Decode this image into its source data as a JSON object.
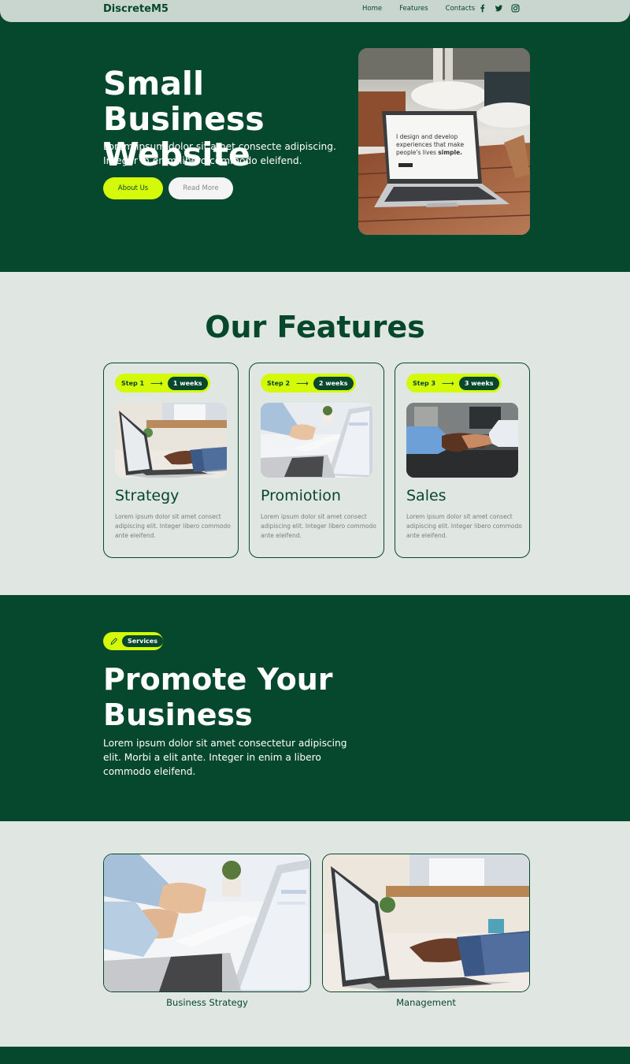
{
  "nav": {
    "brand": "DiscreteM5",
    "links": [
      "Home",
      "Features",
      "Contacts"
    ],
    "social_icons": [
      "facebook-icon",
      "twitter-icon",
      "instagram-icon"
    ]
  },
  "hero": {
    "title": "Small Business Website",
    "subtitle": "Lorem ipsum dolor sit amet consecte adipiscing. Integer in enim libero commodo eleifend.",
    "primary_button": "About Us",
    "secondary_button": "Read More",
    "image_screen_text": "I design and develop experiences that make people's lives simple."
  },
  "features": {
    "title": "Our Features",
    "cards": [
      {
        "step": "Step 1",
        "duration": "1 weeks",
        "title": "Strategy",
        "text": "Lorem ipsum dolor sit amet consect adipiscing elit. Integer libero commodo ante eleifend."
      },
      {
        "step": "Step 2",
        "duration": "2 weeks",
        "title": "Promiotion",
        "text": "Lorem ipsum dolor sit amet consect adipiscing elit. Integer libero commodo ante eleifend."
      },
      {
        "step": "Step 3",
        "duration": "3 weeks",
        "title": "Sales",
        "text": "Lorem ipsum dolor sit amet consect adipiscing elit. Integer libero commodo ante eleifend."
      }
    ]
  },
  "services": {
    "badge": "Services",
    "title": "Promote Your Business",
    "subtitle": "Lorem ipsum dolor sit amet consectetur adipiscing elit. Morbi a elit ante. Integer in enim a libero commodo eleifend."
  },
  "gallery": {
    "items": [
      {
        "caption": "Business Strategy"
      },
      {
        "caption": "Management"
      }
    ]
  },
  "colors": {
    "dark_green": "#06482d",
    "lime": "#d4fa0a",
    "light_bg": "#e0e6e2",
    "nav_bg": "#c9d6cf"
  }
}
